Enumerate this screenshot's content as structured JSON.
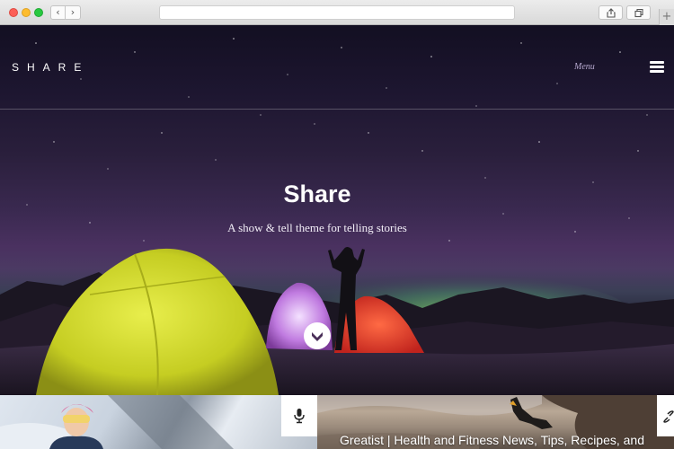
{
  "browser": {
    "back_label": "‹",
    "forward_label": "›",
    "new_tab_label": "+"
  },
  "site": {
    "brand": "SHARE",
    "menu_label": "Menu"
  },
  "hero": {
    "title": "Share",
    "subtitle": "A show & tell theme for telling stories"
  },
  "cards": [
    {
      "title": "",
      "icon": "microphone-icon"
    },
    {
      "title": "Greatist | Health and Fitness News, Tips, Recipes, and",
      "icon": "link-icon"
    }
  ],
  "colors": {
    "sky_top": "#130f22",
    "sky_mid": "#3a2950",
    "aurora": "#7fcf5a",
    "tent_yellow": "#d6e02a",
    "tent_red": "#e4352b",
    "tent_purple": "#c07be0"
  }
}
